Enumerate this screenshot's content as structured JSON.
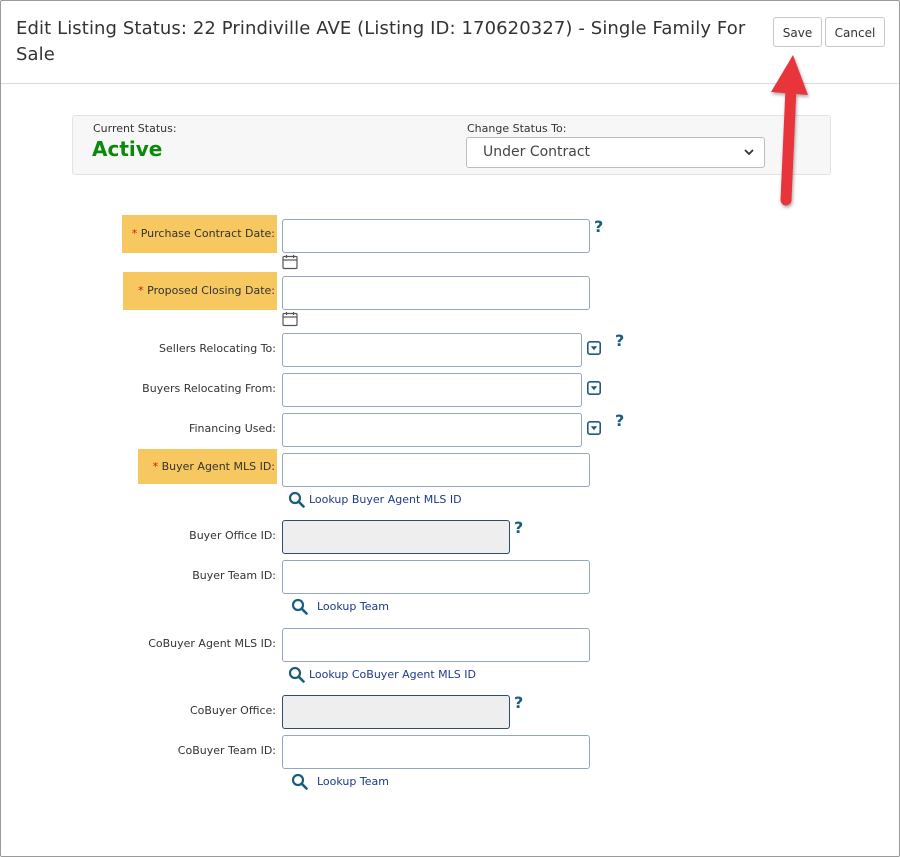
{
  "dialog": {
    "title": "Edit Listing Status: 22 Prindiville AVE (Listing ID: 170620327) - Single Family For Sale",
    "save_label": "Save",
    "cancel_label": "Cancel"
  },
  "status": {
    "current_label": "Current Status:",
    "current_value": "Active",
    "change_label": "Change Status To:",
    "change_value": "Under Contract"
  },
  "form": {
    "required_marker": "*",
    "help_glyph": "?",
    "purchase_contract_date": {
      "label": "Purchase Contract Date:",
      "value": ""
    },
    "proposed_closing_date": {
      "label": "Proposed Closing Date:",
      "value": ""
    },
    "sellers_relocating_to": {
      "label": "Sellers Relocating To:",
      "value": ""
    },
    "buyers_relocating_from": {
      "label": "Buyers Relocating From:",
      "value": ""
    },
    "financing_used": {
      "label": "Financing Used:",
      "value": ""
    },
    "buyer_agent_mls_id": {
      "label": "Buyer Agent MLS ID:",
      "value": "",
      "lookup": "Lookup Buyer Agent MLS ID"
    },
    "buyer_office_id": {
      "label": "Buyer Office ID:",
      "value": ""
    },
    "buyer_team_id": {
      "label": "Buyer Team ID:",
      "value": "",
      "lookup": "Lookup Team"
    },
    "cobuyer_agent_mls_id": {
      "label": "CoBuyer Agent MLS ID:",
      "value": "",
      "lookup": "Lookup CoBuyer Agent MLS ID"
    },
    "cobuyer_office": {
      "label": "CoBuyer Office:",
      "value": ""
    },
    "cobuyer_team_id": {
      "label": "CoBuyer Team ID:",
      "value": "",
      "lookup": "Lookup Team"
    }
  },
  "icons": {
    "calendar": "calendar-icon",
    "dropdown": "dropdown-icon",
    "help": "help-icon",
    "search": "search-icon",
    "arrow": "annotation-arrow"
  },
  "colors": {
    "active_status": "#0a8a0a",
    "required_highlight": "#f6c85f",
    "required_star": "#d0171b",
    "help_icon": "#1b5d7a",
    "link": "#1e3a8a",
    "annotation_arrow": "#e8353b"
  }
}
